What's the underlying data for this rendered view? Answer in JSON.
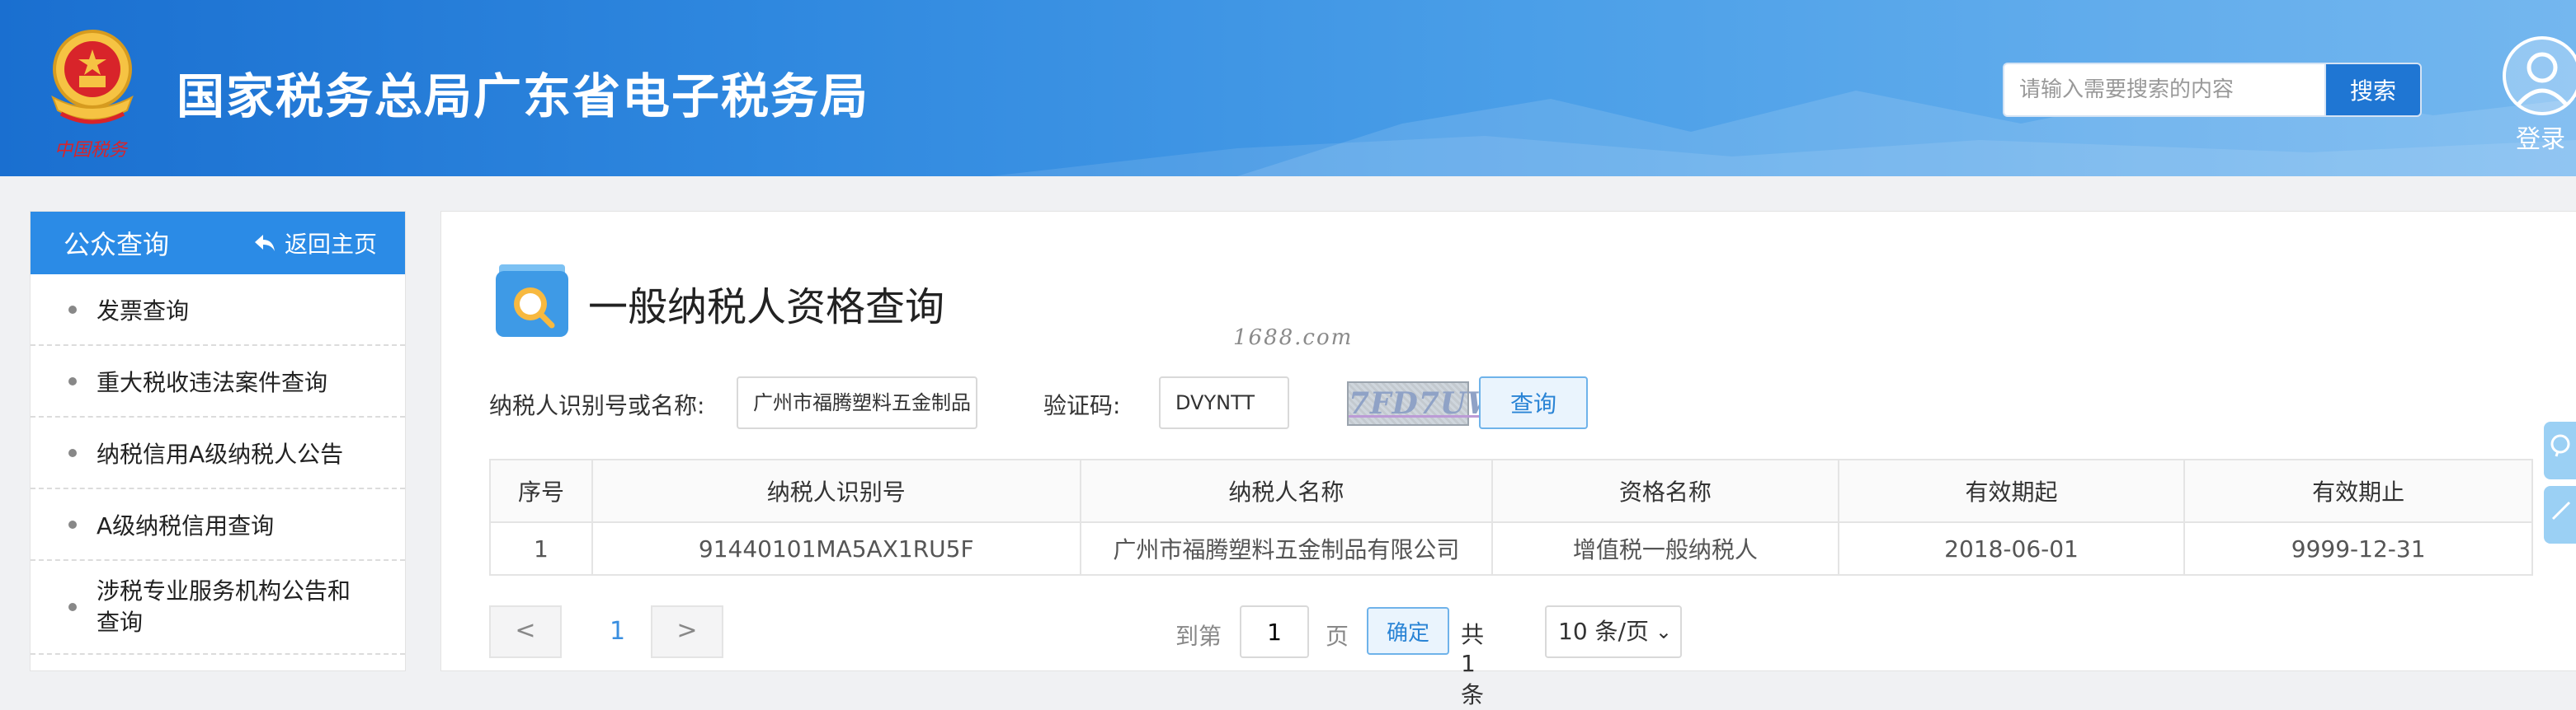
{
  "header": {
    "site_title": "国家税务总局广东省电子税务局",
    "emblem_caption": "中国税务",
    "search_placeholder": "请输入需要搜索的内容",
    "search_button": "搜索",
    "login_label": "登录"
  },
  "sidebar": {
    "title": "公众查询",
    "back_label": "返回主页",
    "items": [
      {
        "label": "发票查询"
      },
      {
        "label": "重大税收违法案件查询"
      },
      {
        "label": "纳税信用A级纳税人公告"
      },
      {
        "label": "A级纳税信用查询"
      },
      {
        "label": "涉税专业服务机构公告和查询"
      }
    ]
  },
  "main": {
    "page_title": "一般纳税人资格查询",
    "watermark": "1688.com",
    "form": {
      "taxpayer_label": "纳税人识别号或名称:",
      "taxpayer_value": "广州市福腾塑料五金制品",
      "captcha_label": "验证码:",
      "captcha_value": "DVYNTT",
      "captcha_image_text": "7FD7UW",
      "query_button": "查询"
    },
    "table": {
      "headers": [
        "序号",
        "纳税人识别号",
        "纳税人名称",
        "资格名称",
        "有效期起",
        "有效期止"
      ],
      "rows": [
        [
          "1",
          "91440101MA5AX1RU5F",
          "广州市福腾塑料五金制品有限公司",
          "增值税一般纳税人",
          "2018-06-01",
          "9999-12-31"
        ]
      ]
    },
    "pager": {
      "prev": "<",
      "current_page": "1",
      "next": ">",
      "goto_label": "到第",
      "goto_value": "1",
      "page_unit": "页",
      "confirm": "确定",
      "total": "共 1 条",
      "page_size": "10 条/页"
    }
  },
  "colors": {
    "header_blue": "#1f76d3",
    "sidebar_head": "#2b8be6",
    "accent": "#2a84d5"
  }
}
